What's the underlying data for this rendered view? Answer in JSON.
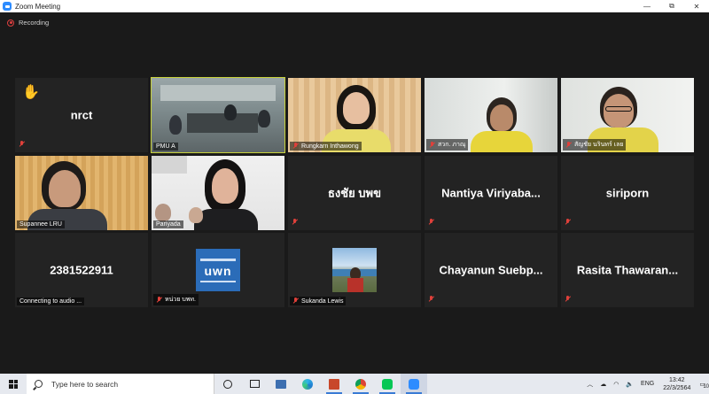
{
  "window": {
    "title": "Zoom Meeting",
    "minimize": "—",
    "maximize": "⧉",
    "close": "✕"
  },
  "recording": {
    "label": "Recording"
  },
  "tiles": [
    {
      "id": "nrct",
      "big_name": "nrct",
      "caption": ""
    },
    {
      "id": "pmu",
      "caption": "PMU A"
    },
    {
      "id": "rungkarn",
      "caption": "Rungkarn Inthawong"
    },
    {
      "id": "sakk",
      "caption": "สวก. ภาณุ"
    },
    {
      "id": "sanchai",
      "caption": "สัญชัย นรินทร์ เลย"
    },
    {
      "id": "supannee",
      "caption": "Supannee LRU"
    },
    {
      "id": "pariyada",
      "caption": "Pariyada"
    },
    {
      "id": "thongchai",
      "big_name": "ธงชัย บพข"
    },
    {
      "id": "nantiya",
      "big_name": "Nantiya  Viriyaba..."
    },
    {
      "id": "siriporn",
      "big_name": "siriporn"
    },
    {
      "id": "phone",
      "big_name": "2381522911",
      "caption": "Connecting to audio ..."
    },
    {
      "id": "uwn",
      "caption": "หน่วย บพท.",
      "logo_text": "uwn"
    },
    {
      "id": "sukanda",
      "caption": "Sukanda Lewis"
    },
    {
      "id": "chayanun",
      "big_name": "Chayanun  Suebp..."
    },
    {
      "id": "rasita",
      "big_name": "Rasita  Thawaran..."
    }
  ],
  "taskbar": {
    "search_placeholder": "Type here to search",
    "language": "ENG",
    "time": "13:42",
    "date": "22/3/2564",
    "notification_count": "10"
  },
  "colors": {
    "active_speaker": "#c8d23a",
    "muted": "#e0403a",
    "zoom_blue": "#2d8cff"
  }
}
